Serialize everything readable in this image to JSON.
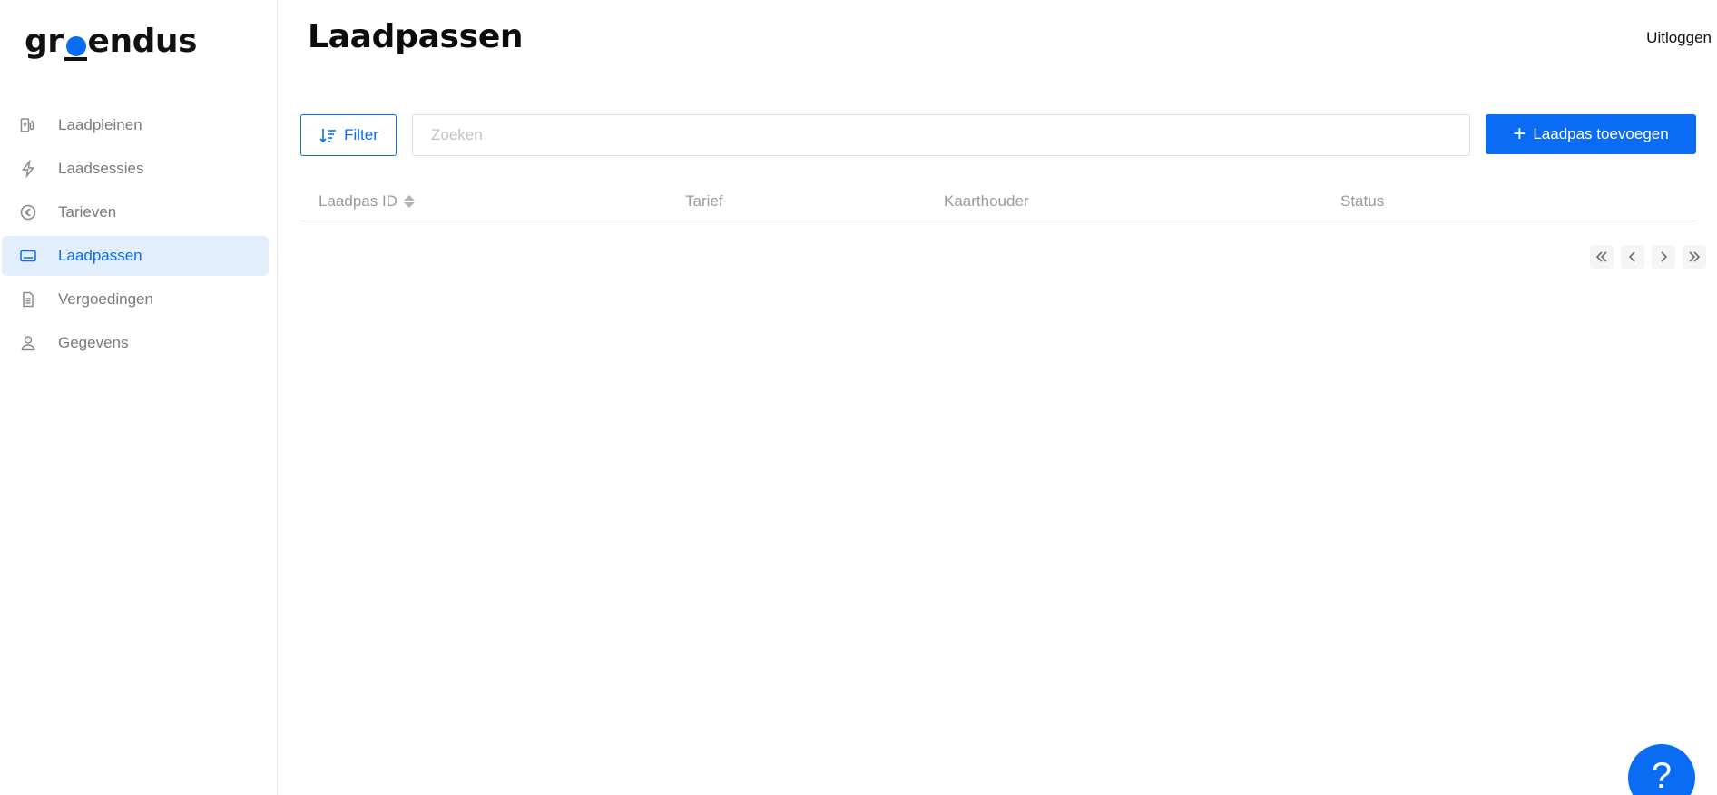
{
  "logo": {
    "part1": "gr",
    "part2": "endus"
  },
  "sidebar": {
    "items": [
      {
        "label": "Laadpleinen",
        "icon": "charging-station-icon",
        "active": false
      },
      {
        "label": "Laadsessies",
        "icon": "lightning-icon",
        "active": false
      },
      {
        "label": "Tarieven",
        "icon": "euro-icon",
        "active": false
      },
      {
        "label": "Laadpassen",
        "icon": "card-icon",
        "active": true
      },
      {
        "label": "Vergoedingen",
        "icon": "document-icon",
        "active": false
      },
      {
        "label": "Gegevens",
        "icon": "user-icon",
        "active": false
      }
    ]
  },
  "header": {
    "title": "Laadpassen",
    "logout_label": "Uitloggen"
  },
  "toolbar": {
    "filter_label": "Filter",
    "search_placeholder": "Zoeken",
    "search_value": "",
    "add_label": "Laadpas toevoegen"
  },
  "table": {
    "columns": [
      "Laadpas ID",
      "Tarief",
      "Kaarthouder",
      "Status"
    ],
    "rows": []
  },
  "help": {
    "label": "?"
  },
  "colors": {
    "accent": "#0a6cf5",
    "active_bg": "#e3eefc"
  }
}
